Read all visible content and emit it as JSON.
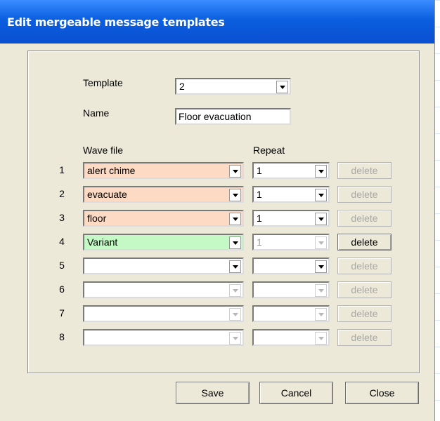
{
  "window": {
    "title": "Edit mergeable message templates"
  },
  "form": {
    "template_label": "Template",
    "template_value": "2",
    "name_label": "Name",
    "name_value": "Floor evacuation",
    "wave_header": "Wave file",
    "repeat_header": "Repeat"
  },
  "rows": [
    {
      "num": "1",
      "wave": "alert chime",
      "repeat": "1",
      "delete": "delete"
    },
    {
      "num": "2",
      "wave": "evacuate",
      "repeat": "1",
      "delete": "delete"
    },
    {
      "num": "3",
      "wave": "floor",
      "repeat": "1",
      "delete": "delete"
    },
    {
      "num": "4",
      "wave": "Variant",
      "repeat": "1",
      "delete": "delete"
    },
    {
      "num": "5",
      "wave": "",
      "repeat": "",
      "delete": "delete"
    },
    {
      "num": "6",
      "wave": "",
      "repeat": "",
      "delete": "delete"
    },
    {
      "num": "7",
      "wave": "",
      "repeat": "",
      "delete": "delete"
    },
    {
      "num": "8",
      "wave": "",
      "repeat": "",
      "delete": "delete"
    }
  ],
  "colors": {
    "wave_filled": "#fcdac4",
    "wave_variant": "#c4f8c4",
    "titlebar": "#0b5fe0"
  },
  "icons": {
    "dropdown": "chevron-down-icon"
  },
  "buttons": {
    "save": "Save",
    "cancel": "Cancel",
    "close": "Close"
  }
}
